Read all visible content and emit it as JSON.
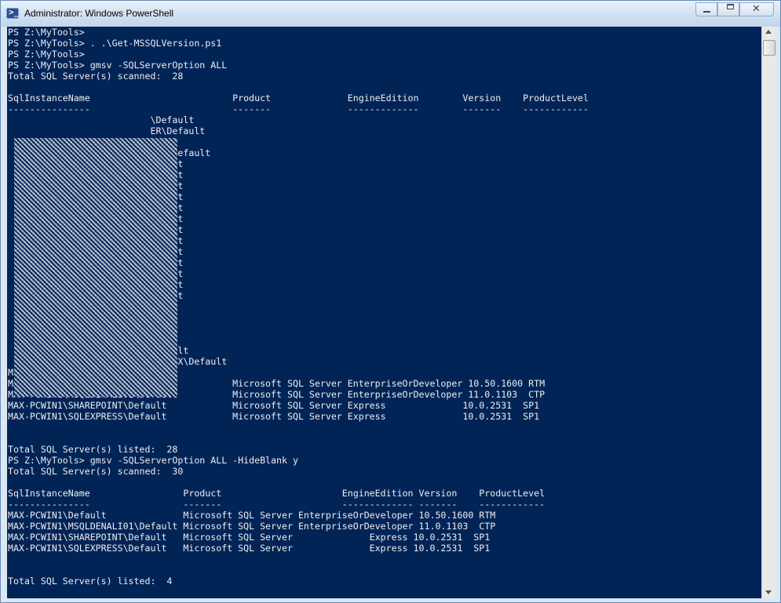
{
  "window": {
    "title": "Administrator: Windows PowerShell",
    "icon": "powershell-icon",
    "controls": {
      "minimize": "minimize-icon",
      "maximize": "restore-icon",
      "close": "close-icon"
    }
  },
  "colors": {
    "console_bg": "#012456",
    "console_fg": "#eeedf0"
  },
  "console": {
    "lines": [
      "PS Z:\\MyTools>",
      "PS Z:\\MyTools> . .\\Get-MSSQLVersion.ps1",
      "PS Z:\\MyTools>",
      "PS Z:\\MyTools> gmsv -SQLServerOption ALL",
      "Total SQL Server(s) scanned:  28",
      "",
      "SqlInstanceName                          Product              EngineEdition        Version    ProductLevel",
      "---------------                          -------              -------------        -------    ------------",
      "                          \\Default",
      "                          ER\\Default",
      "",
      "                          TP1\\Default",
      "                         Default",
      "                         Default",
      "                         Default",
      "                         Default",
      "                         Default",
      "                         Default",
      "                         Default",
      "                         Default",
      "                         Default",
      "                         Default",
      "                         Default",
      "                         Default",
      "                         Default",
      "                          ault",
      "                          ault",
      "                          ault",
      "",
      "                          Default",
      "                          INETIX\\Default",
      "MSO-SRV-DEVM\\SQLEXPRESS\\Default",
      "MAX-PCWIN1\\Default                       Microsoft SQL Server EnterpriseOrDeveloper 10.50.1600 RTM",
      "MAX-PCWIN1\\MSQLDENALI01\\Default          Microsoft SQL Server EnterpriseOrDeveloper 11.0.1103  CTP",
      "MAX-PCWIN1\\SHAREPOINT\\Default            Microsoft SQL Server Express              10.0.2531  SP1",
      "MAX-PCWIN1\\SQLEXPRESS\\Default            Microsoft SQL Server Express              10.0.2531  SP1",
      "",
      "",
      "Total SQL Server(s) listed:  28",
      "PS Z:\\MyTools> gmsv -SQLServerOption ALL -HideBlank y",
      "Total SQL Server(s) scanned:  30",
      "",
      "SqlInstanceName                 Product                      EngineEdition Version    ProductLevel",
      "---------------                 -------                      ------------- -------    ------------",
      "MAX-PCWIN1\\Default              Microsoft SQL Server EnterpriseOrDeveloper 10.50.1600 RTM",
      "MAX-PCWIN1\\MSQLDENALI01\\Default Microsoft SQL Server EnterpriseOrDeveloper 11.0.1103  CTP",
      "MAX-PCWIN1\\SHAREPOINT\\Default   Microsoft SQL Server              Express 10.0.2531  SP1",
      "MAX-PCWIN1\\SQLEXPRESS\\Default   Microsoft SQL Server              Express 10.0.2531  SP1",
      "",
      "",
      "Total SQL Server(s) listed:  4",
      "",
      "PS Z:\\MyTools>"
    ]
  }
}
